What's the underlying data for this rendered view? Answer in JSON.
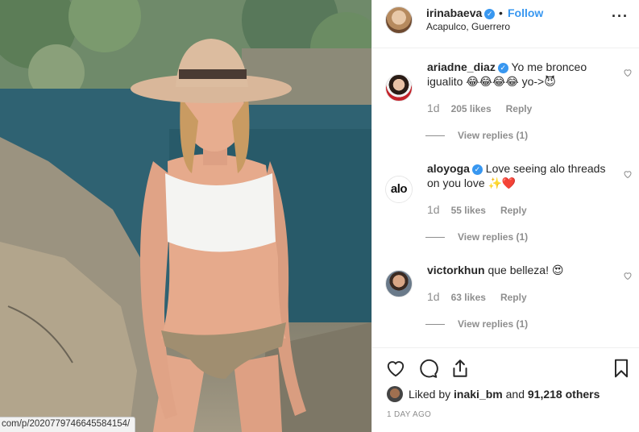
{
  "post": {
    "username": "irinabaeva",
    "dot": "•",
    "follow_label": "Follow",
    "location": "Acapulco, Guerrero",
    "more_icon": "more-options-icon"
  },
  "comments": [
    {
      "username": "ariadne_diaz",
      "text": "Yo me bronceo igualito 😂😂😂😂 yo->😈",
      "time": "1d",
      "likes": "205 likes",
      "reply": "Reply",
      "view_replies": "View replies (1)"
    },
    {
      "username": "aloyoga",
      "avatar_text": "alo",
      "text": "Love seeing alo threads on you love ✨❤️",
      "time": "1d",
      "likes": "55 likes",
      "reply": "Reply",
      "view_replies": "View replies (1)"
    },
    {
      "username": "victorkhun",
      "text": "que belleza! 😍",
      "time": "1d",
      "likes": "63 likes",
      "reply": "Reply",
      "view_replies": "View replies (1)"
    }
  ],
  "liked_by": {
    "prefix": "Liked by",
    "user": "inaki_bm",
    "and": "and",
    "count": "91,218 others"
  },
  "posted_ago": "1 DAY AGO",
  "status_url": "com/p/2020779746645584154/",
  "colors": {
    "accent": "#3897f0",
    "muted": "#8e8e8e",
    "text": "#262626",
    "border": "#efefef"
  }
}
